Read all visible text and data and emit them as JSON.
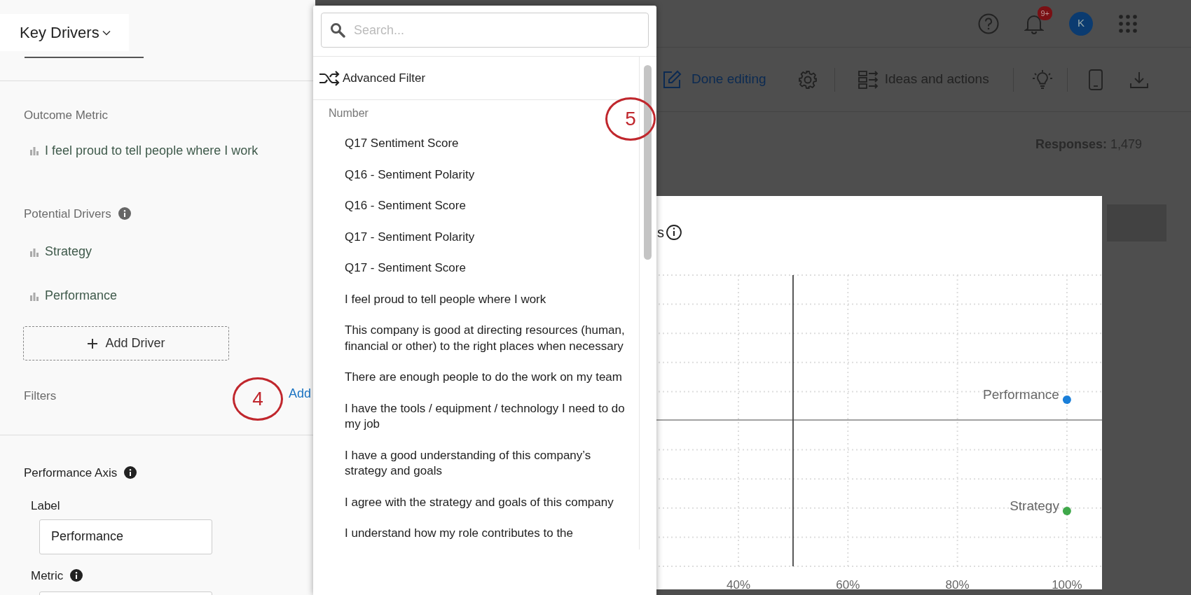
{
  "widget_title": "Key Drivers",
  "outcome_metric": {
    "label": "Outcome Metric",
    "items": [
      "I feel proud to tell people where I work"
    ]
  },
  "potential_drivers": {
    "label": "Potential Drivers",
    "items": [
      "Strategy",
      "Performance"
    ],
    "add_button": "Add Driver"
  },
  "filters": {
    "label": "Filters",
    "callout": "4",
    "add_link": "Add"
  },
  "performance_axis": {
    "label": "Performance Axis",
    "field_label": "Label",
    "field_value": "Performance",
    "metric_label": "Metric"
  },
  "dropdown": {
    "search_placeholder": "Search...",
    "advanced_filter": "Advanced Filter",
    "callout": "5",
    "group": "Number",
    "items": [
      {
        "text": "Q17 Sentiment Score"
      },
      {
        "text": "Q16 - Sentiment Polarity"
      },
      {
        "text": "Q16 - Sentiment Score"
      },
      {
        "text": "Q17 - Sentiment Polarity"
      },
      {
        "text": "Q17 - Sentiment Score"
      },
      {
        "text": "I feel proud to tell people where I work"
      },
      {
        "text": "This company is good at directing resources (human, financial or other) to the right places when necessary"
      },
      {
        "text": "There are enough people to do the work on my team"
      },
      {
        "text": "I have the tools / equipment / technology I need to do my job"
      },
      {
        "text": "I have a good understanding of this company’s strategy and goals"
      },
      {
        "text": "I agree with the strategy and goals of this company"
      },
      {
        "text": "I understand how my role contributes to the"
      }
    ]
  },
  "top_bar": {
    "notification_badge": "9+",
    "avatar": "K"
  },
  "toolbar": {
    "done_editing": "Done editing",
    "ideas": "Ideas and actions"
  },
  "responses": {
    "label": "Responses:",
    "value": "1,479"
  },
  "chart": {
    "title": "s",
    "x_tick_labels": [
      "40%",
      "60%",
      "80%",
      "100%"
    ],
    "points": [
      {
        "label": "Performance",
        "color": "#1a7fd9"
      },
      {
        "label": "Strategy",
        "color": "#3fa84a"
      }
    ]
  }
}
